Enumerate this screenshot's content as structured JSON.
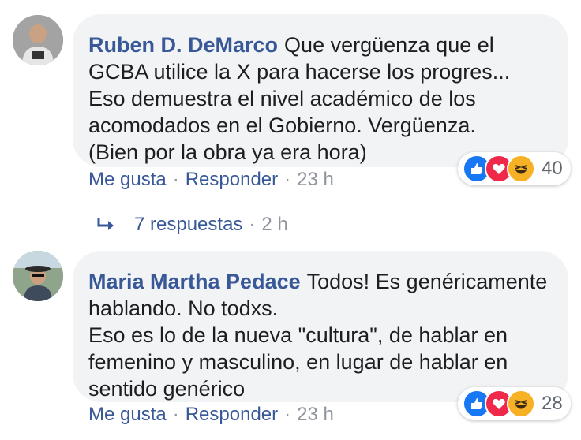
{
  "comments": [
    {
      "author": "Ruben D. DeMarco",
      "text": "Que vergüenza que el GCBA utilice la X para hacerse los progres... Eso demuestra el nivel académico de los acomodados en el Gobierno. Vergüenza.\n(Bien por la obra ya era hora)",
      "reaction_count": "40",
      "reaction_icons": [
        "like-icon",
        "love-icon",
        "haha-icon"
      ],
      "like_label": "Me gusta",
      "reply_label": "Responder",
      "time": "23 h"
    },
    {
      "author": "Maria Martha Pedace",
      "text": "Todos! Es genéricamente hablando. No todxs.\nEso es lo de la nueva \"cultura\", de hablar en femenino y masculino, en lugar de hablar en sentido genérico",
      "reaction_count": "28",
      "reaction_icons": [
        "like-icon",
        "love-icon",
        "haha-icon"
      ],
      "like_label": "Me gusta",
      "reply_label": "Responder",
      "time": "23 h"
    }
  ],
  "replies": {
    "label": "7 respuestas",
    "time": "2 h"
  },
  "separator": "·",
  "colors": {
    "link": "#385898",
    "meta": "#90949c",
    "bubble": "#f2f3f5",
    "like": "#1877f2",
    "love": "#f0284a",
    "haha": "#f7b125"
  }
}
